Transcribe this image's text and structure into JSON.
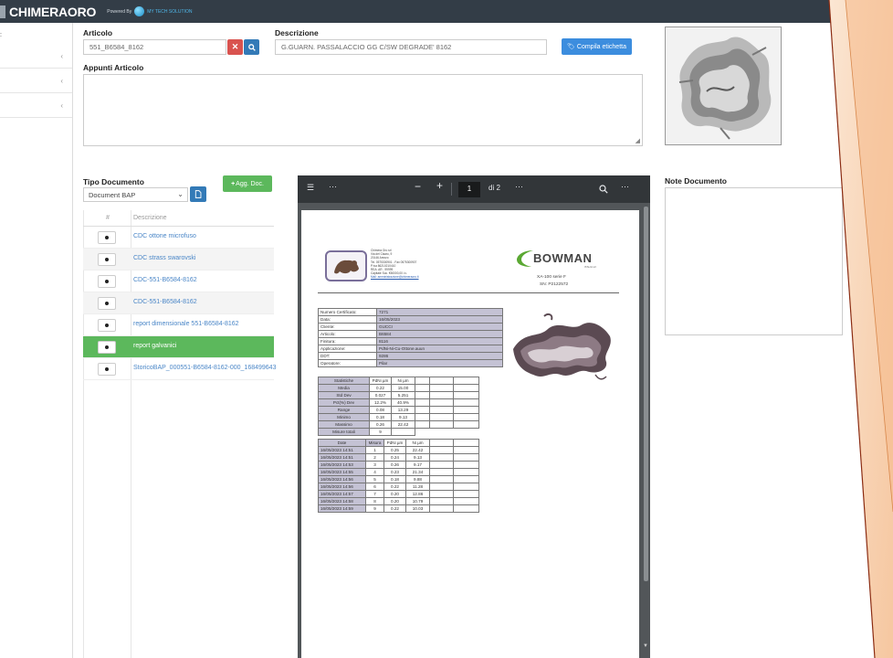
{
  "header": {
    "app_title": "CHIMERAORO",
    "powered_by": "Powered By",
    "powered_brand": "MY TECH SOLUTION"
  },
  "sidebar": {
    "items": [
      "",
      "",
      ""
    ]
  },
  "articolo": {
    "label": "Articolo",
    "value": "551_B6584_8162"
  },
  "descrizione": {
    "label": "Descrizione",
    "value": "G.GUARN. PASSALACCIO GG C/SW DEGRADE' 8162"
  },
  "compila_button": "Compila etichetta",
  "appunti_label": "Appunti Articolo",
  "tipo_documento": {
    "label": "Tipo Documento",
    "selected": "Document BAP",
    "add_button": "Agg. Doc."
  },
  "documents_table": {
    "col_index": "#",
    "col_desc": "Descrizione",
    "rows": [
      "CDC ottone microfuso",
      "CDC strass swarovski",
      "CDC-551-B6584-8162",
      "CDC-551-B6584-8162",
      "report dimensionale 551-B6584-8162",
      "report galvanici",
      "StoricoBAP_000551-B6584-8162-000_168499643"
    ],
    "selected_index": 5
  },
  "viewer": {
    "page_current": "1",
    "page_total": "di 2",
    "document": {
      "company_lines": [
        "Chimera Oro srl",
        "Via del Cisaro, 9",
        "20146 Arezzo",
        "Tel. 0575300901 - Fax 0575300907",
        "P.Iva 86210210410",
        "REA: AR - 99999",
        "Capitale Soc. €50000,00 i.v.",
        "Mail: amministrazione@chimeraoro.it"
      ],
      "brand": "BOWMAN",
      "brand_sub": "ITALIA srl",
      "instrument": "XA-100 serie F",
      "serial": "SN: P2122572",
      "info_rows": [
        [
          "Numero Certificato:",
          "7271"
        ],
        [
          "Data:",
          "16/05/2023"
        ],
        [
          "Cliente:",
          "GUCCI"
        ],
        [
          "Articolo:",
          "B6584"
        ],
        [
          "Finitura:",
          "8116"
        ],
        [
          "Applicazione:",
          "PdNi-Ni-Cu-Ottone.auun"
        ],
        [
          "DDT:",
          "9286"
        ],
        [
          "Operatore:",
          "Pilar"
        ]
      ],
      "stats_header": [
        "Statistiche",
        "PdNi µm",
        "Ni µm"
      ],
      "stats_rows": [
        [
          "Media",
          "0.22",
          "15.00"
        ],
        [
          "Std Dev",
          "0.027",
          "5.251"
        ],
        [
          "Pct(%) Dev",
          "12.2%",
          "40.9%"
        ],
        [
          "Range",
          "0.08",
          "13.29"
        ],
        [
          "Minimo",
          "0.18",
          "9.13"
        ],
        [
          "Massimo",
          "0.26",
          "22.42"
        ],
        [
          "Misure totali",
          "9",
          ""
        ]
      ],
      "meas_header": [
        "Date",
        "Misura",
        "PdNi µm",
        "Ni µm"
      ],
      "meas_rows": [
        [
          "16/05/2023 14:51",
          "1",
          "0.25",
          "22.42"
        ],
        [
          "16/05/2023 14:51",
          "2",
          "0.24",
          "9.13"
        ],
        [
          "16/05/2023 14:53",
          "3",
          "0.26",
          "9.17"
        ],
        [
          "16/05/2023 14:55",
          "4",
          "0.23",
          "21.34"
        ],
        [
          "16/05/2023 14:56",
          "5",
          "0.18",
          "9.88"
        ],
        [
          "16/05/2023 14:56",
          "6",
          "0.22",
          "11.28"
        ],
        [
          "16/05/2023 14:57",
          "7",
          "0.20",
          "12.86"
        ],
        [
          "16/05/2023 14:58",
          "8",
          "0.20",
          "10.79"
        ],
        [
          "16/05/2023 14:59",
          "9",
          "0.22",
          "10.03"
        ]
      ]
    }
  },
  "note_documento_label": "Note Documento",
  "colors": {
    "topbar": "#333d47",
    "accent_blue": "#337ab7",
    "selected_green": "#5cb85c",
    "deco_orange": "#f7c9a4"
  },
  "icons": {
    "clear": "times-icon",
    "search": "search-icon",
    "tag": "tag-icon",
    "plus": "plus-icon",
    "file": "file-icon",
    "eye": "eye-icon"
  }
}
